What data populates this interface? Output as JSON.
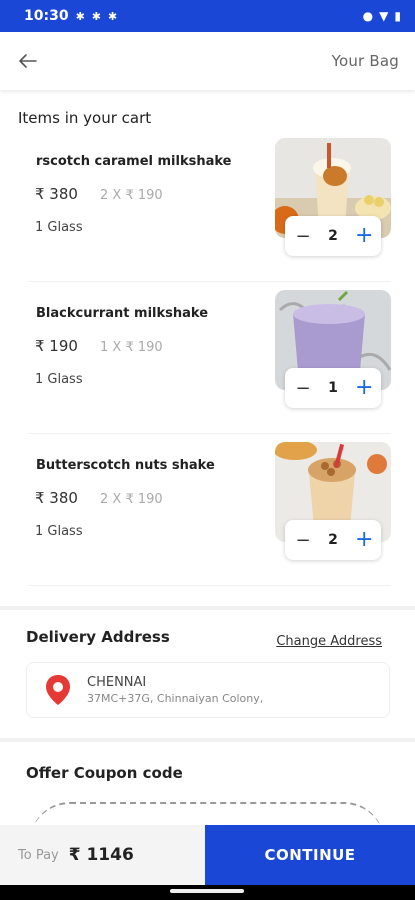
{
  "status_bar": {
    "time": "10:30",
    "icons": [
      "notification-icon",
      "notification-icon",
      "notification-icon"
    ]
  },
  "header": {
    "title": "Your Bag"
  },
  "cart": {
    "title": "Items in your cart",
    "items": [
      {
        "name": "rscotch caramel milkshake",
        "price": "₹ 380",
        "calc": "2 X ₹ 190",
        "unit": "1 Glass",
        "qty": "2"
      },
      {
        "name": "Blackcurrant milkshake",
        "price": "₹ 190",
        "calc": "1 X ₹ 190",
        "unit": "1 Glass",
        "qty": "1"
      },
      {
        "name": "Butterscotch nuts shake",
        "price": "₹ 380",
        "calc": "2 X ₹ 190",
        "unit": "1 Glass",
        "qty": "2"
      }
    ],
    "minus_symbol": "−",
    "plus_symbol": "+"
  },
  "delivery": {
    "title": "Delivery Address",
    "change_label": "Change Address",
    "city": "CHENNAI",
    "line": "37MC+37G, Chinnaiyan Colony,"
  },
  "coupon": {
    "title": "Offer Coupon code"
  },
  "footer": {
    "pay_label": "To Pay",
    "pay_amount": "₹ 1146",
    "continue_label": "CONTINUE"
  },
  "colors": {
    "primary": "#1a47d6",
    "accent": "#1a6be0",
    "pin": "#e53935"
  }
}
